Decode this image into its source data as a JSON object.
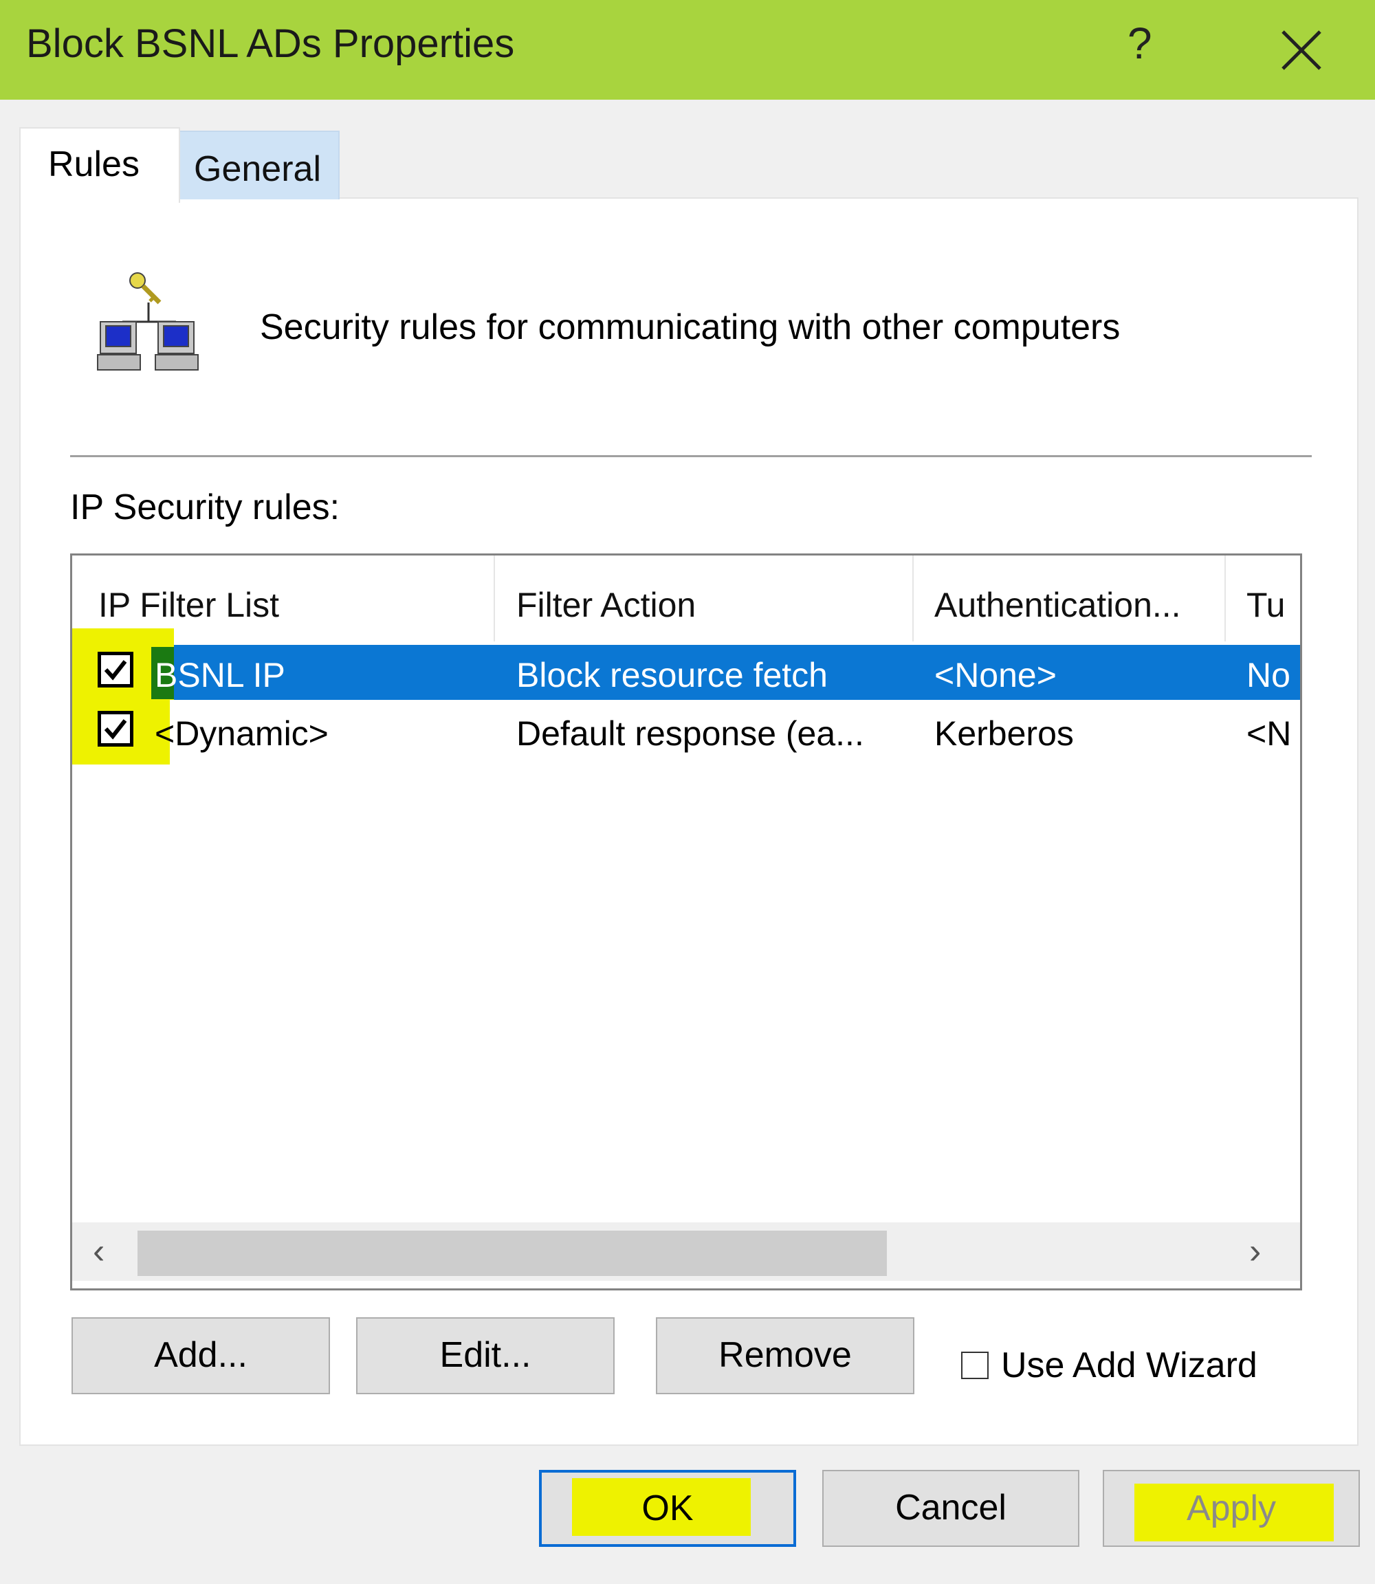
{
  "window": {
    "title": "Block BSNL ADs Properties",
    "help_label": "?",
    "accent_color": "#a8d43e"
  },
  "tabs": [
    {
      "label": "Rules",
      "active": true
    },
    {
      "label": "General",
      "active": false
    }
  ],
  "description": "Security rules for communicating with other computers",
  "rules_label": "IP Security rules:",
  "columns": [
    "IP Filter List",
    "Filter Action",
    "Authentication...",
    "Tu"
  ],
  "rows": [
    {
      "checked": true,
      "filter_list": "BSNL IP",
      "filter_action": "Block resource fetch",
      "authentication": "<None>",
      "tunnel": "No",
      "selected": true
    },
    {
      "checked": true,
      "filter_list": "<Dynamic>",
      "filter_action": "Default response (ea...",
      "authentication": "Kerberos",
      "tunnel": "<N",
      "selected": false
    }
  ],
  "scroll": {
    "left_arrow": "‹",
    "right_arrow": "›"
  },
  "buttons": {
    "add": "Add...",
    "edit": "Edit...",
    "remove": "Remove",
    "use_add_wizard": "Use Add Wizard",
    "ok": "OK",
    "cancel": "Cancel",
    "apply": "Apply"
  },
  "use_add_wizard_checked": false,
  "highlight_color": "#eef200",
  "selection_color": "#0b77d3"
}
